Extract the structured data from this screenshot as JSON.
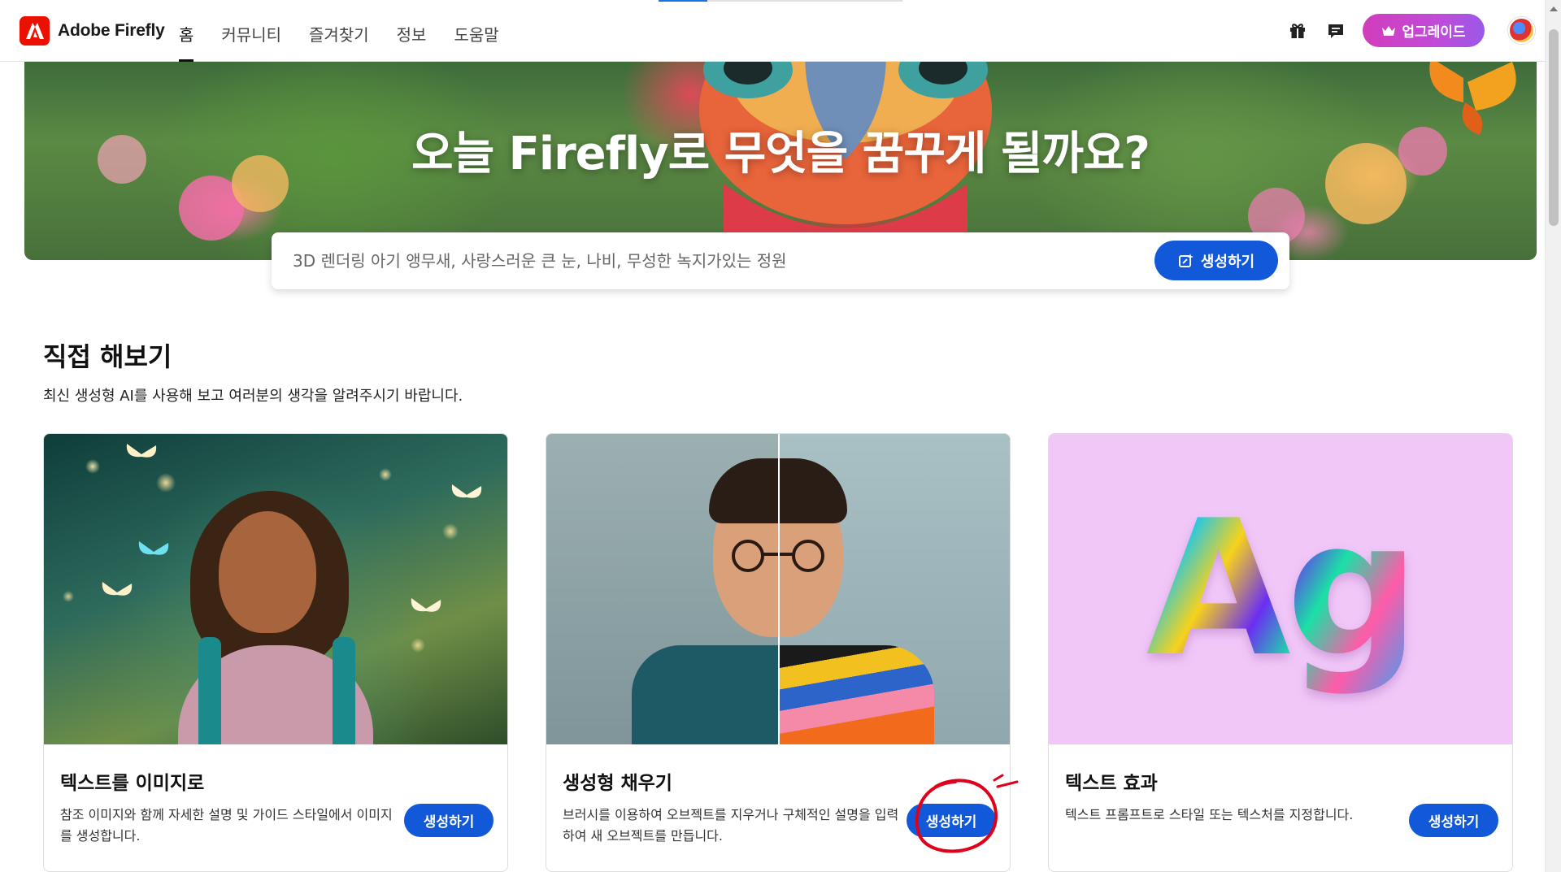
{
  "header": {
    "brand": "Adobe Firefly",
    "nav": [
      {
        "label": "홈",
        "active": true
      },
      {
        "label": "커뮤니티",
        "active": false
      },
      {
        "label": "즐겨찾기",
        "active": false
      },
      {
        "label": "정보",
        "active": false
      },
      {
        "label": "도움말",
        "active": false
      }
    ],
    "icons": [
      "gift-icon",
      "chat-icon"
    ],
    "upgrade_label": "업그레이드"
  },
  "hero": {
    "title": "오늘 Firefly로 무엇을 꿈꾸게 될까요?",
    "prompt_placeholder": "3D 렌더링 아기 앵무새, 사랑스러운 큰 눈, 나비, 무성한 녹지가있는 정원",
    "generate_label": "생성하기"
  },
  "section": {
    "title": "직접 해보기",
    "subtitle": "최신 생성형 AI를 사용해 보고 여러분의 생각을 알려주시기 바랍니다."
  },
  "cards": [
    {
      "title": "텍스트를 이미지로",
      "description": "참조 이미지와 함께 자세한 설명 및 가이드 스타일에서 이미지를 생성합니다.",
      "button": "생성하기"
    },
    {
      "title": "생성형 채우기",
      "description": "브러시를 이용하여 오브젝트를 지우거나 구체적인 설명을 입력하여 새 오브젝트를 만듭니다.",
      "button": "생성하기"
    },
    {
      "title": "텍스트 효과",
      "description": "텍스트 프롬프트로 스타일 또는 텍스처를 지정합니다.",
      "button": "생성하기",
      "sample_text": "Ag"
    }
  ],
  "colors": {
    "brand_red": "#eb1000",
    "primary_blue": "#1159d8",
    "upgrade_gradient_start": "#d23dbb",
    "upgrade_gradient_end": "#9b59e8",
    "annotation_red": "#e0001b"
  }
}
